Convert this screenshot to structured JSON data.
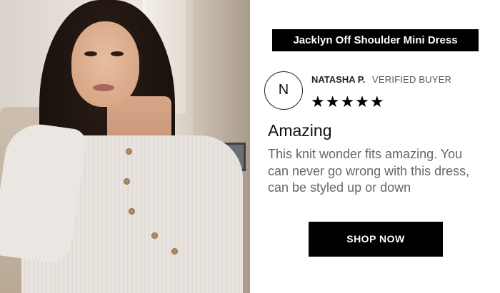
{
  "product": {
    "title": "Jacklyn Off Shoulder Mini Dress"
  },
  "review": {
    "avatar_initial": "N",
    "reviewer_name": "NATASHA P.",
    "verified_label": "VERIFIED BUYER",
    "rating": 5,
    "stars_text": "★★★★★",
    "title": "Amazing",
    "body": "This knit wonder fits amazing. You can never go wrong with this dress, can be styled up or down"
  },
  "cta": {
    "label": "SHOP NOW"
  },
  "colors": {
    "badge_background": "#000000",
    "button_background": "#000000",
    "body_text": "#666666",
    "page_background": "#ffffff"
  },
  "icons": {
    "star": "star-icon"
  }
}
